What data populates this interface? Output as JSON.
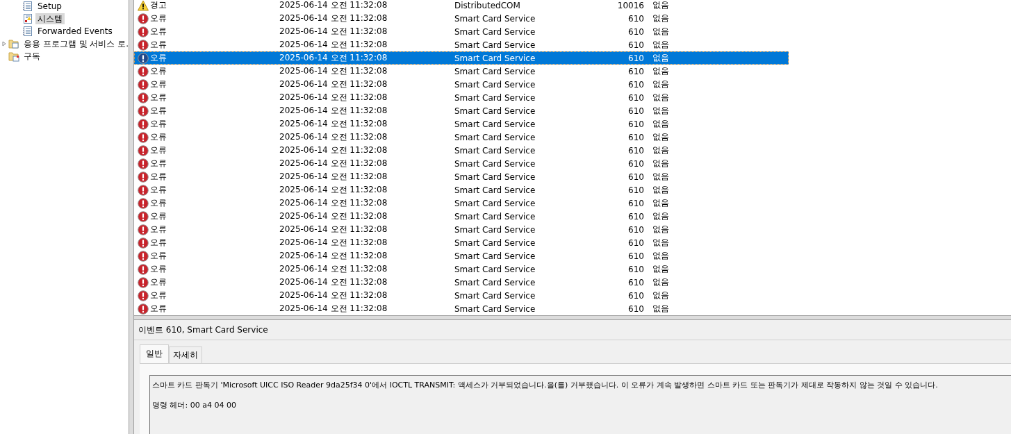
{
  "tree": {
    "items": [
      {
        "children": [
          {
            "label": "Setup",
            "kind": "log",
            "selected": false
          },
          {
            "label": "시스템",
            "kind": "syslog",
            "selected": true
          },
          {
            "label": "Forwarded Events",
            "kind": "log",
            "selected": false
          }
        ]
      },
      {
        "label": "응용 프로그램 및 서비스 로.",
        "kind": "folder",
        "expanded": false,
        "selected": false
      },
      {
        "label": "구독",
        "kind": "subscription",
        "selected": false
      }
    ]
  },
  "events": {
    "rows": [
      {
        "kind": "warning",
        "level": "경고",
        "date": "2025-06-14 오전 11:32:08",
        "source": "DistributedCOM",
        "event_id": "10016",
        "category": "없음",
        "selected": false
      },
      {
        "kind": "error",
        "level": "오류",
        "date": "2025-06-14 오전 11:32:08",
        "source": "Smart Card Service",
        "event_id": "610",
        "category": "없음",
        "selected": false
      },
      {
        "kind": "error",
        "level": "오류",
        "date": "2025-06-14 오전 11:32:08",
        "source": "Smart Card Service",
        "event_id": "610",
        "category": "없음",
        "selected": false
      },
      {
        "kind": "error",
        "level": "오류",
        "date": "2025-06-14 오전 11:32:08",
        "source": "Smart Card Service",
        "event_id": "610",
        "category": "없음",
        "selected": false
      },
      {
        "kind": "error",
        "level": "오류",
        "date": "2025-06-14 오전 11:32:08",
        "source": "Smart Card Service",
        "event_id": "610",
        "category": "없음",
        "selected": true
      },
      {
        "kind": "error",
        "level": "오류",
        "date": "2025-06-14 오전 11:32:08",
        "source": "Smart Card Service",
        "event_id": "610",
        "category": "없음",
        "selected": false
      },
      {
        "kind": "error",
        "level": "오류",
        "date": "2025-06-14 오전 11:32:08",
        "source": "Smart Card Service",
        "event_id": "610",
        "category": "없음",
        "selected": false
      },
      {
        "kind": "error",
        "level": "오류",
        "date": "2025-06-14 오전 11:32:08",
        "source": "Smart Card Service",
        "event_id": "610",
        "category": "없음",
        "selected": false
      },
      {
        "kind": "error",
        "level": "오류",
        "date": "2025-06-14 오전 11:32:08",
        "source": "Smart Card Service",
        "event_id": "610",
        "category": "없음",
        "selected": false
      },
      {
        "kind": "error",
        "level": "오류",
        "date": "2025-06-14 오전 11:32:08",
        "source": "Smart Card Service",
        "event_id": "610",
        "category": "없음",
        "selected": false
      },
      {
        "kind": "error",
        "level": "오류",
        "date": "2025-06-14 오전 11:32:08",
        "source": "Smart Card Service",
        "event_id": "610",
        "category": "없음",
        "selected": false
      },
      {
        "kind": "error",
        "level": "오류",
        "date": "2025-06-14 오전 11:32:08",
        "source": "Smart Card Service",
        "event_id": "610",
        "category": "없음",
        "selected": false
      },
      {
        "kind": "error",
        "level": "오류",
        "date": "2025-06-14 오전 11:32:08",
        "source": "Smart Card Service",
        "event_id": "610",
        "category": "없음",
        "selected": false
      },
      {
        "kind": "error",
        "level": "오류",
        "date": "2025-06-14 오전 11:32:08",
        "source": "Smart Card Service",
        "event_id": "610",
        "category": "없음",
        "selected": false
      },
      {
        "kind": "error",
        "level": "오류",
        "date": "2025-06-14 오전 11:32:08",
        "source": "Smart Card Service",
        "event_id": "610",
        "category": "없음",
        "selected": false
      },
      {
        "kind": "error",
        "level": "오류",
        "date": "2025-06-14 오전 11:32:08",
        "source": "Smart Card Service",
        "event_id": "610",
        "category": "없음",
        "selected": false
      },
      {
        "kind": "error",
        "level": "오류",
        "date": "2025-06-14 오전 11:32:08",
        "source": "Smart Card Service",
        "event_id": "610",
        "category": "없음",
        "selected": false
      },
      {
        "kind": "error",
        "level": "오류",
        "date": "2025-06-14 오전 11:32:08",
        "source": "Smart Card Service",
        "event_id": "610",
        "category": "없음",
        "selected": false
      },
      {
        "kind": "error",
        "level": "오류",
        "date": "2025-06-14 오전 11:32:08",
        "source": "Smart Card Service",
        "event_id": "610",
        "category": "없음",
        "selected": false
      },
      {
        "kind": "error",
        "level": "오류",
        "date": "2025-06-14 오전 11:32:08",
        "source": "Smart Card Service",
        "event_id": "610",
        "category": "없음",
        "selected": false
      },
      {
        "kind": "error",
        "level": "오류",
        "date": "2025-06-14 오전 11:32:08",
        "source": "Smart Card Service",
        "event_id": "610",
        "category": "없음",
        "selected": false
      },
      {
        "kind": "error",
        "level": "오류",
        "date": "2025-06-14 오전 11:32:08",
        "source": "Smart Card Service",
        "event_id": "610",
        "category": "없음",
        "selected": false
      },
      {
        "kind": "error",
        "level": "오류",
        "date": "2025-06-14 오전 11:32:08",
        "source": "Smart Card Service",
        "event_id": "610",
        "category": "없음",
        "selected": false
      },
      {
        "kind": "error",
        "level": "오류",
        "date": "2025-06-14 오전 11:32:08",
        "source": "Smart Card Service",
        "event_id": "610",
        "category": "없음",
        "selected": false
      }
    ]
  },
  "details": {
    "title": "이벤트 610, Smart Card Service",
    "tabs": [
      {
        "label": "일반",
        "selected": true
      },
      {
        "label": "자세히",
        "selected": false
      }
    ],
    "paragraphs": [
      "스마트 카드 판독기 'Microsoft UICC ISO Reader 9da25f34 0'에서 IOCTL TRANSMIT: 액세스가 거부되었습니다.을(를) 거부했습니다. 이 오류가 계속 발생하면 스마트 카드 또는 판독기가 제대로 작동하지 않는 것일 수 있습니다.",
      "명령 헤더: 00 a4 04 00"
    ]
  }
}
